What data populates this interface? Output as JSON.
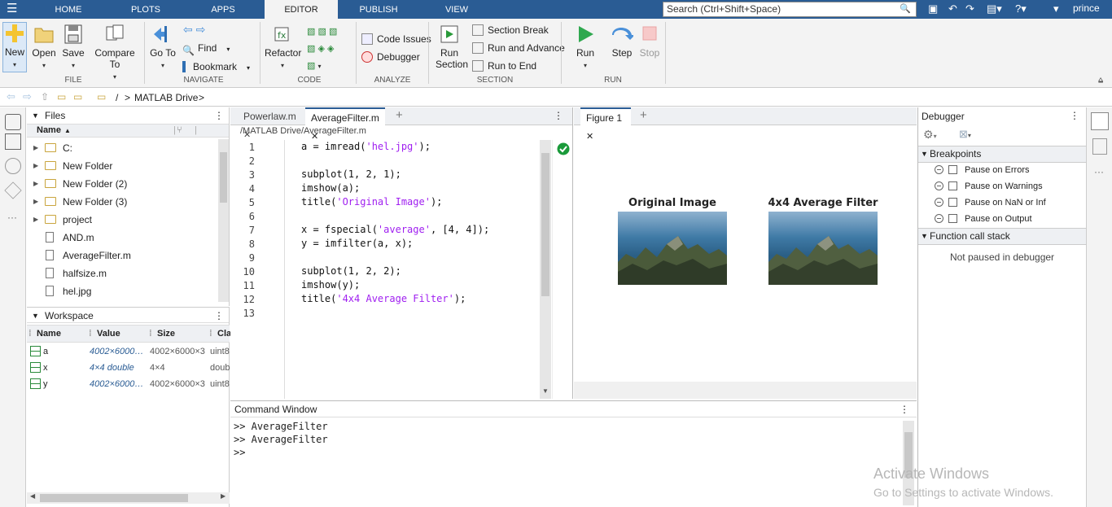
{
  "topbar": {
    "tabs": [
      "HOME",
      "PLOTS",
      "APPS",
      "EDITOR",
      "PUBLISH",
      "VIEW"
    ],
    "active_tab": "EDITOR",
    "search_placeholder": "Search (Ctrl+Shift+Space)",
    "user": "prince"
  },
  "ribbon": {
    "file": {
      "new": "New",
      "open": "Open",
      "save": "Save",
      "compare": "Compare To",
      "group": "FILE"
    },
    "navigate": {
      "goto": "Go To",
      "find": "Find",
      "bookmark": "Bookmark",
      "group": "NAVIGATE"
    },
    "code": {
      "refactor": "Refactor",
      "group": "CODE"
    },
    "analyze": {
      "code_issues": "Code Issues",
      "debugger": "Debugger",
      "group": "ANALYZE"
    },
    "section": {
      "run_section": "Run Section",
      "section_break": "Section Break",
      "run_and_advance": "Run and Advance",
      "run_to_end": "Run to End",
      "group": "SECTION"
    },
    "run": {
      "run": "Run",
      "step": "Step",
      "stop": "Stop",
      "group": "RUN"
    }
  },
  "address": {
    "root": "/",
    "separator": ">",
    "folder": "MATLAB Drive",
    "trail": ">"
  },
  "files": {
    "title": "Files",
    "column": "Name",
    "items": [
      {
        "name": "C:",
        "type": "folder"
      },
      {
        "name": "New Folder",
        "type": "folder"
      },
      {
        "name": "New Folder (2)",
        "type": "folder"
      },
      {
        "name": "New Folder (3)",
        "type": "folder"
      },
      {
        "name": "project",
        "type": "folder"
      },
      {
        "name": "AND.m",
        "type": "file"
      },
      {
        "name": "AverageFilter.m",
        "type": "file"
      },
      {
        "name": "halfsize.m",
        "type": "file"
      },
      {
        "name": "hel.jpg",
        "type": "image"
      }
    ]
  },
  "workspace": {
    "title": "Workspace",
    "columns": [
      "Name",
      "Value",
      "Size",
      "Cla"
    ],
    "rows": [
      {
        "name": "a",
        "value": "4002×6000…",
        "size": "4002×6000×3",
        "class": "uint8"
      },
      {
        "name": "x",
        "value": "4×4 double",
        "size": "4×4",
        "class": "doub"
      },
      {
        "name": "y",
        "value": "4002×6000…",
        "size": "4002×6000×3",
        "class": "uint8"
      }
    ]
  },
  "editor": {
    "tabs": [
      "Powerlaw.m",
      "AverageFilter.m"
    ],
    "active_tab": "AverageFilter.m",
    "path": "/MATLAB Drive/AverageFilter.m",
    "lines": [
      "1",
      "2",
      "3",
      "4",
      "5",
      "6",
      "7",
      "8",
      "9",
      "10",
      "11",
      "12",
      "13"
    ]
  },
  "figure": {
    "tab": "Figure 1",
    "title_left": "Original Image",
    "title_right": "4x4 Average Filter"
  },
  "command": {
    "title": "Command Window",
    "lines": [
      ">> AverageFilter",
      ">> AverageFilter",
      ">>"
    ]
  },
  "debugger": {
    "title": "Debugger",
    "breakpoints_label": "Breakpoints",
    "breakpoints": [
      "Pause on Errors",
      "Pause on Warnings",
      "Pause on NaN or Inf",
      "Pause on Output"
    ],
    "callstack_label": "Function call stack",
    "callstack_status": "Not paused in debugger"
  },
  "watermark": {
    "line1": "Activate Windows",
    "line2": "Go to Settings to activate Windows."
  },
  "colors": {
    "topbar": "#2a5c94",
    "string": "#a020f0",
    "ok_green": "#1a9a3a"
  }
}
